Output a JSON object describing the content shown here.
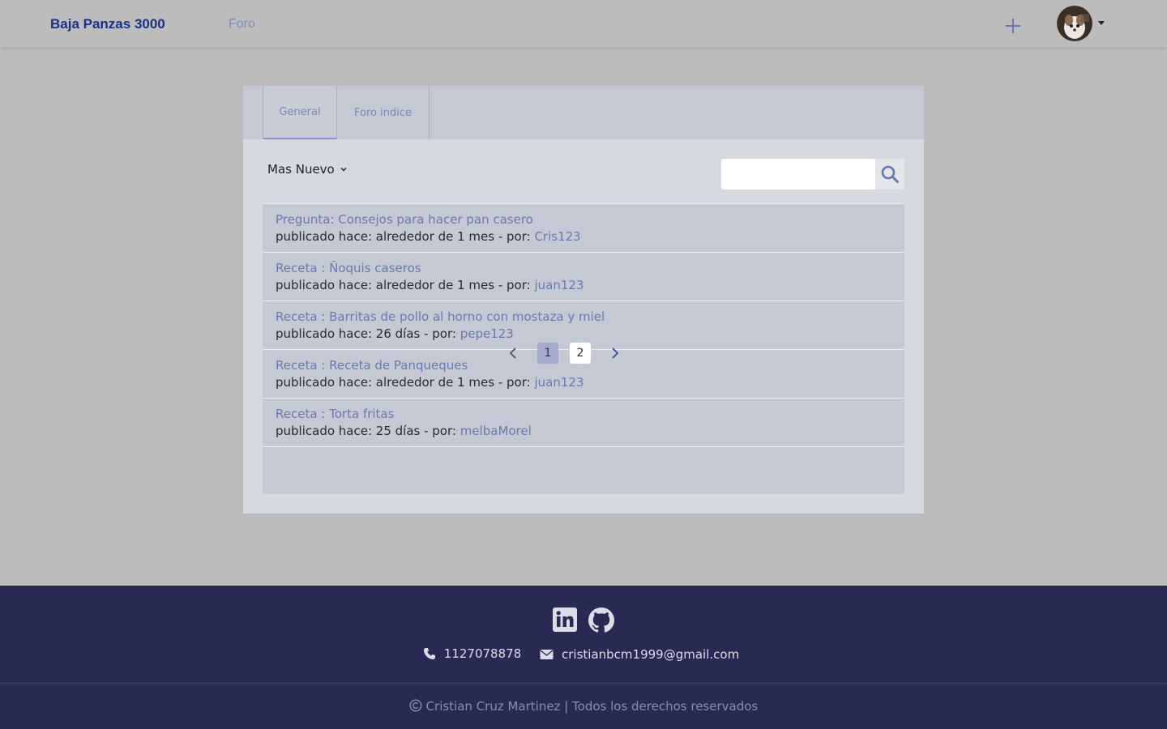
{
  "nav": {
    "brand": "Baja Panzas 3000",
    "link": "Foro",
    "add_icon": "plus-icon",
    "avatar_icon": "user-avatar",
    "menu_icon": "caret-down-icon"
  },
  "tabs": [
    {
      "label": "General",
      "active": true
    },
    {
      "label": "Foro indice",
      "active": false
    }
  ],
  "sort": {
    "label": "Mas Nuevo",
    "icon": "chevron-down-icon"
  },
  "search": {
    "placeholder": "",
    "value": "",
    "icon": "search-icon"
  },
  "posts": [
    {
      "title": "Pregunta: Consejos para hacer pan casero",
      "meta_prefix": "publicado hace: alrededor de 1 mes - por: ",
      "author": "Cris123"
    },
    {
      "title": "Receta : Ñoquis caseros",
      "meta_prefix": "publicado hace: alrededor de 1 mes - por: ",
      "author": "juan123"
    },
    {
      "title": "Receta : Barritas de pollo al horno con mostaza y miel",
      "meta_prefix": "publicado hace: 26 días - por: ",
      "author": "pepe123"
    },
    {
      "title": "Receta : Receta de Panqueques",
      "meta_prefix": "publicado hace: alrededor de 1 mes - por: ",
      "author": "juan123"
    },
    {
      "title": "Receta : Torta fritas",
      "meta_prefix": "publicado hace: 25 días - por: ",
      "author": "melbaMorel"
    }
  ],
  "pagination": {
    "pages": [
      "1",
      "2"
    ],
    "current": "1",
    "prev_icon": "chevron-left-icon",
    "next_icon": "chevron-right-icon"
  },
  "footer": {
    "social_icons": [
      "linkedin-icon",
      "github-icon"
    ],
    "phone": "1127078878",
    "email": "cristianbcm1999@gmail.com",
    "copyright": "Cristian Cruz Martinez | Todos los derechos reservados"
  },
  "colors": {
    "brand": "#1e2f86",
    "accent": "#6b79ad",
    "footer_bg": "#292a53",
    "page_bg": "#bcbcbc"
  }
}
